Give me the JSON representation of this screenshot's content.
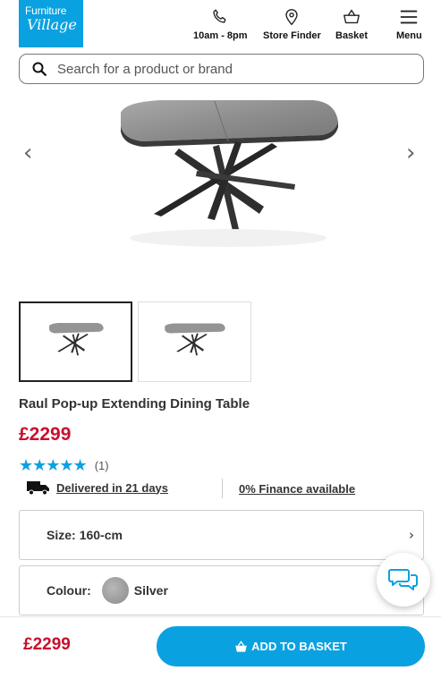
{
  "brand": {
    "line1": "Furniture",
    "line2": "Village"
  },
  "header": {
    "hours_label": "10am - 8pm",
    "store_label": "Store Finder",
    "basket_label": "Basket",
    "menu_label": "Menu"
  },
  "search": {
    "placeholder": "Search for a product or brand"
  },
  "gallery": {
    "prev_glyph": "‹",
    "next_glyph": "›"
  },
  "product": {
    "title": "Raul Pop-up Extending Dining Table",
    "price": "£2299",
    "rating": 5,
    "stars": "★★★★★",
    "review_count": "(1)",
    "delivery_text": "Delivered in 21 days",
    "finance_text": "0% Finance available",
    "size_label": "Size:",
    "size_value": "160-cm",
    "colour_label": "Colour:",
    "colour_value": "Silver"
  },
  "footer": {
    "price": "£2299",
    "add_label": "ADD TO BASKET"
  },
  "colors": {
    "brand_blue": "#0aa1e0",
    "price_red": "#c8102e"
  },
  "icons": [
    "phone-icon",
    "location-pin-icon",
    "basket-icon",
    "hamburger-menu-icon",
    "search-icon",
    "delivery-truck-icon",
    "chat-icon"
  ]
}
